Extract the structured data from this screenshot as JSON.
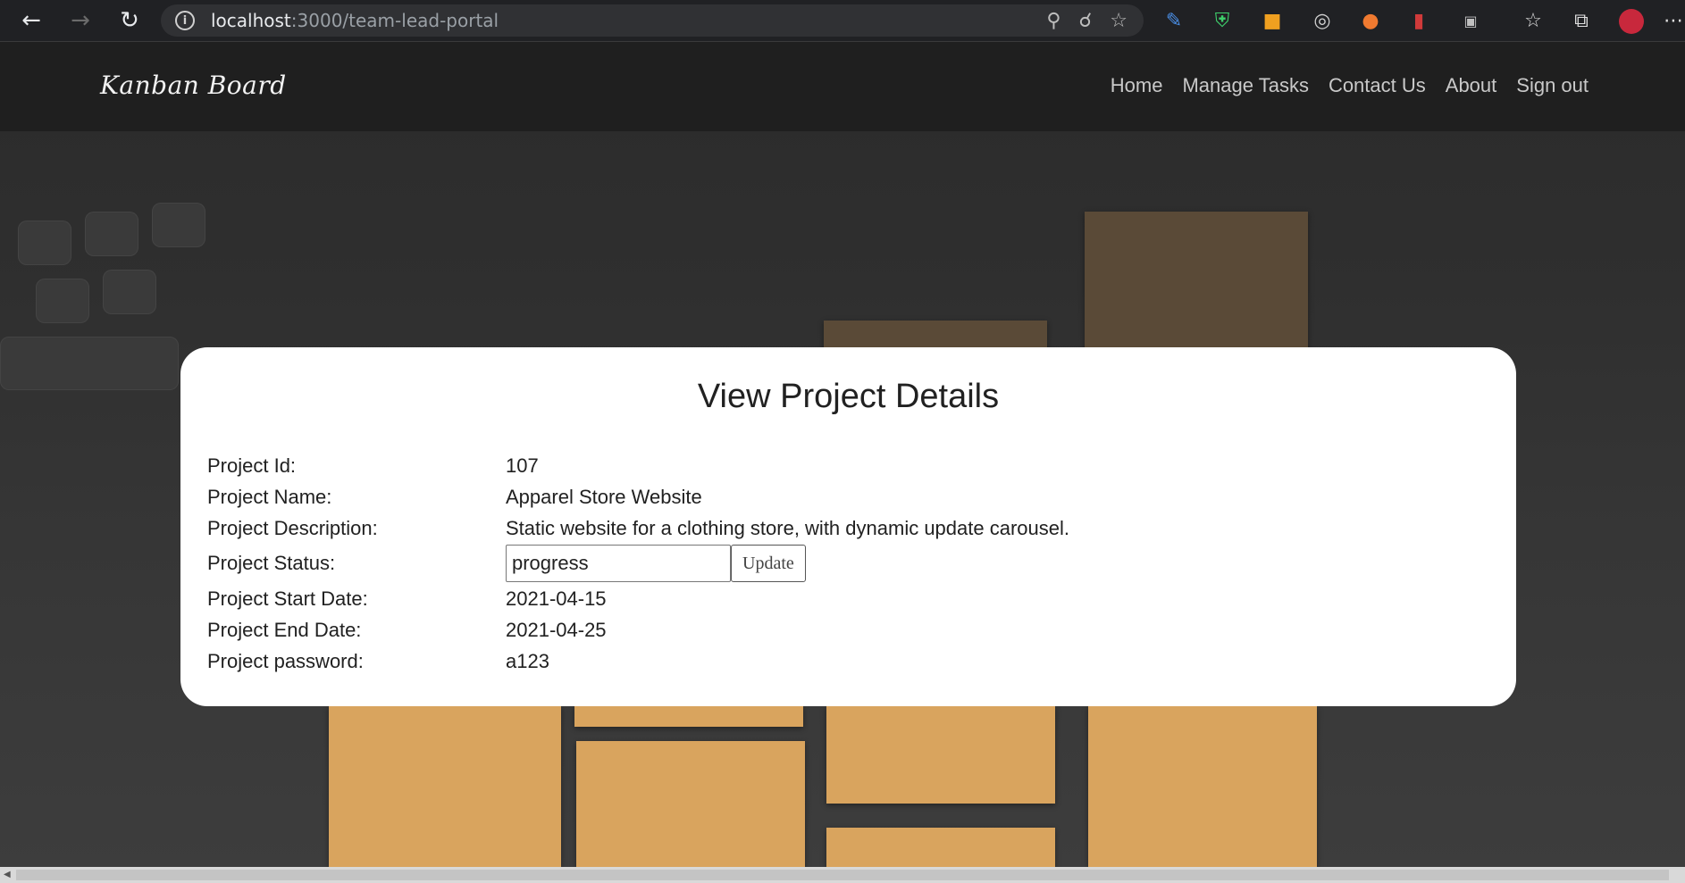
{
  "browser": {
    "back_icon": "arrow-left-icon",
    "forward_icon": "arrow-right-icon",
    "reload_icon": "reload-icon",
    "url_host": "localhost",
    "url_rest": ":3000/team-lead-portal"
  },
  "nav": {
    "brand": "Kanban Board",
    "links": [
      "Home",
      "Manage Tasks",
      "Contact Us",
      "About",
      "Sign out"
    ]
  },
  "card": {
    "title": "View Project Details",
    "fields": [
      {
        "label": "Project Id:",
        "value": "107"
      },
      {
        "label": "Project Name:",
        "value": "Apparel Store Website"
      },
      {
        "label": "Project Description:",
        "value": "Static website for a clothing store, with dynamic update carousel."
      },
      {
        "label": "Project Status:",
        "value": "progress",
        "button": "Update"
      },
      {
        "label": "Project Start Date:",
        "value": "2021-04-15"
      },
      {
        "label": "Project End Date:",
        "value": "2021-04-25"
      },
      {
        "label": "Project password:",
        "value": "a123"
      }
    ]
  }
}
